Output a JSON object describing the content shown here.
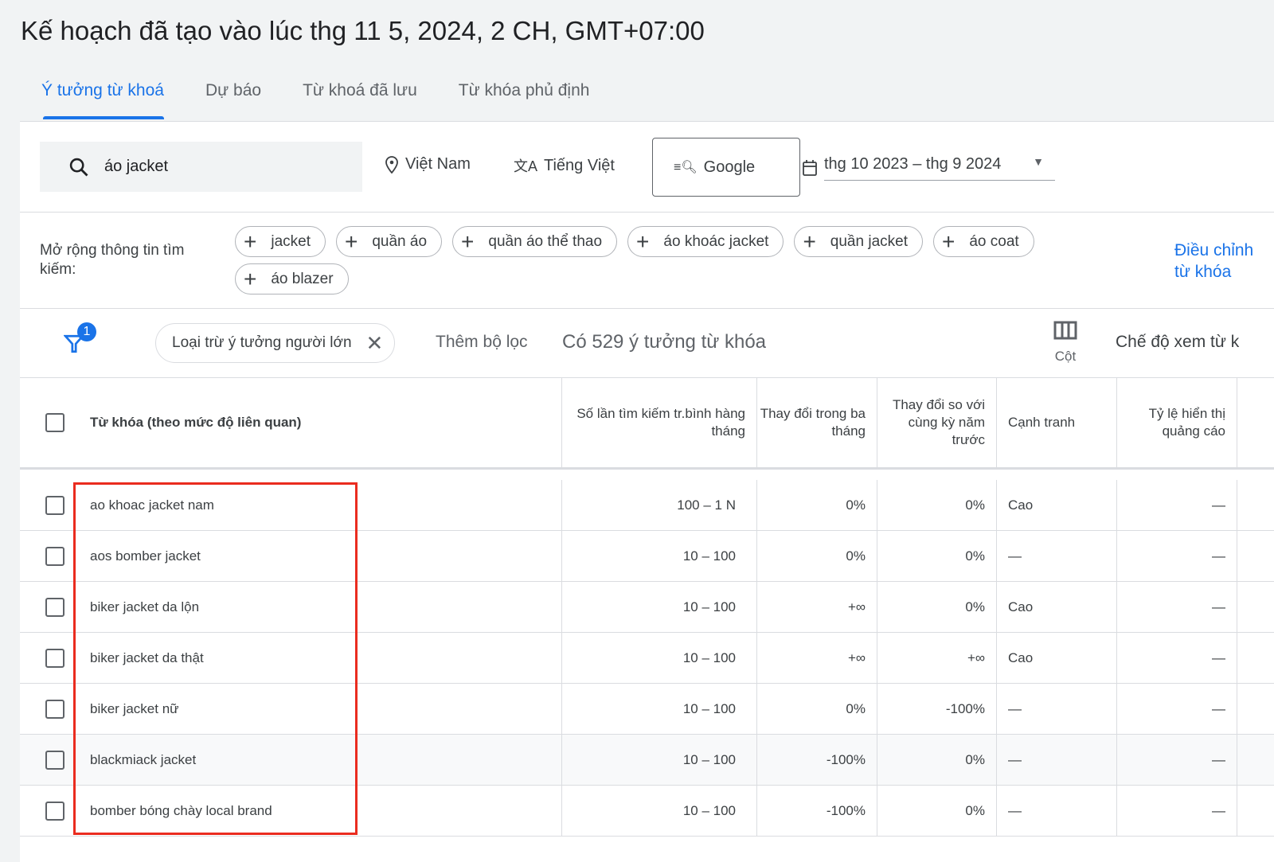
{
  "title": "Kế hoạch đã tạo vào lúc thg 11 5, 2024, 2 CH, GMT+07:00",
  "tabs": [
    {
      "label": "Ý tưởng từ khoá"
    },
    {
      "label": "Dự báo"
    },
    {
      "label": "Từ khoá đã lưu"
    },
    {
      "label": "Từ khóa phủ định"
    }
  ],
  "search": {
    "value": "áo jacket"
  },
  "location": "Việt Nam",
  "language": "Tiếng Việt",
  "network": "Google",
  "date_range": "thg 10 2023 – thg 9 2024",
  "broaden": {
    "label": "Mở rộng thông tin tìm kiếm:",
    "chips": [
      "jacket",
      "quần áo",
      "quần áo thể thao",
      "áo khoác jacket",
      "quần jacket",
      "áo coat",
      "áo blazer"
    ],
    "link": "Điều chỉnh từ khóa"
  },
  "filter": {
    "badge": "1",
    "chip": "Loại trừ ý tưởng người lớn",
    "add": "Thêm bộ lọc",
    "count": "Có 529 ý tưởng từ khóa",
    "columns": "Cột",
    "view": "Chế độ xem từ k"
  },
  "table": {
    "headers": [
      "Từ khóa (theo mức độ liên quan)",
      "Số lần tìm kiếm tr.bình hàng tháng",
      "Thay đổi trong ba tháng",
      "Thay đổi so với cùng kỳ năm trước",
      "Cạnh tranh",
      "Tỷ lệ hiển thị quảng cáo"
    ],
    "rows": [
      [
        "ao khoac jacket nam",
        "100 – 1 N",
        "0%",
        "0%",
        "Cao",
        "—"
      ],
      [
        "aos bomber jacket",
        "10 – 100",
        "0%",
        "0%",
        "—",
        "—"
      ],
      [
        "biker jacket da lộn",
        "10 – 100",
        "+∞",
        "0%",
        "Cao",
        "—"
      ],
      [
        "biker jacket da thật",
        "10 – 100",
        "+∞",
        "+∞",
        "Cao",
        "—"
      ],
      [
        "biker jacket nữ",
        "10 – 100",
        "0%",
        "-100%",
        "—",
        "—"
      ],
      [
        "blackmiack jacket",
        "10 – 100",
        "-100%",
        "0%",
        "—",
        "—"
      ],
      [
        "bomber bóng chày local brand",
        "10 – 100",
        "-100%",
        "0%",
        "—",
        "—"
      ]
    ]
  },
  "colors": {
    "accent": "#1a73e8",
    "highlight_box": "#ea2c1f"
  }
}
